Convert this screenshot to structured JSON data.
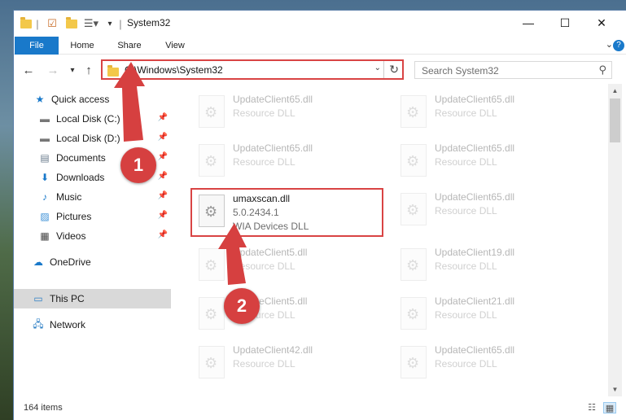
{
  "titlebar": {
    "title": "System32",
    "controls": {
      "minimize": "—",
      "maximize": "☐",
      "close": "✕"
    }
  },
  "ribbon": {
    "tabs": [
      "File",
      "Home",
      "Share",
      "View"
    ],
    "help": "?"
  },
  "navigation": {
    "back": "←",
    "forward": "→",
    "recent": "▾",
    "up": "↑",
    "address": "C:\\Windows\\System32",
    "search_placeholder": "Search System32"
  },
  "sidebar": {
    "items": [
      {
        "label": "Quick access",
        "icon": "star-icon"
      },
      {
        "label": "Local Disk (C:)",
        "icon": "drive-icon"
      },
      {
        "label": "Local Disk (D:)",
        "icon": "drive-icon"
      },
      {
        "label": "Documents",
        "icon": "documents-icon"
      },
      {
        "label": "Downloads",
        "icon": "download-arrow-icon"
      },
      {
        "label": "Music",
        "icon": "music-note-icon"
      },
      {
        "label": "Pictures",
        "icon": "pictures-icon"
      },
      {
        "label": "Videos",
        "icon": "film-icon"
      },
      {
        "label": "OneDrive",
        "icon": "cloud-icon"
      },
      {
        "label": "This PC",
        "icon": "monitor-icon",
        "selected": true
      },
      {
        "label": "Network",
        "icon": "network-icon"
      }
    ]
  },
  "files": {
    "left_column": [
      {
        "name": "UpdateClient65.dll",
        "type": "Resource DLL"
      },
      {
        "name": "UpdateClient65.dll",
        "type": "Resource DLL"
      },
      {
        "name": "umaxscan.dll",
        "version": "5.0.2434.1",
        "type": "WIA Devices DLL",
        "highlighted": true
      },
      {
        "name": "UpdateClient5.dll",
        "type": "Resource DLL"
      },
      {
        "name": "UpdateClient5.dll",
        "type": "Resource DLL"
      },
      {
        "name": "UpdateClient42.dll",
        "type": "Resource DLL"
      }
    ],
    "right_column": [
      {
        "name": "UpdateClient65.dll",
        "type": "Resource DLL"
      },
      {
        "name": "UpdateClient65.dll",
        "type": "Resource DLL"
      },
      {
        "name": "UpdateClient65.dll",
        "type": "Resource DLL"
      },
      {
        "name": "UpdateClient19.dll",
        "type": "Resource DLL"
      },
      {
        "name": "UpdateClient21.dll",
        "type": "Resource DLL"
      },
      {
        "name": "UpdateClient65.dll",
        "type": "Resource DLL"
      }
    ]
  },
  "status": {
    "item_count": "164 items"
  },
  "annotations": {
    "step1": "1",
    "step2": "2",
    "color": "#d64040"
  }
}
